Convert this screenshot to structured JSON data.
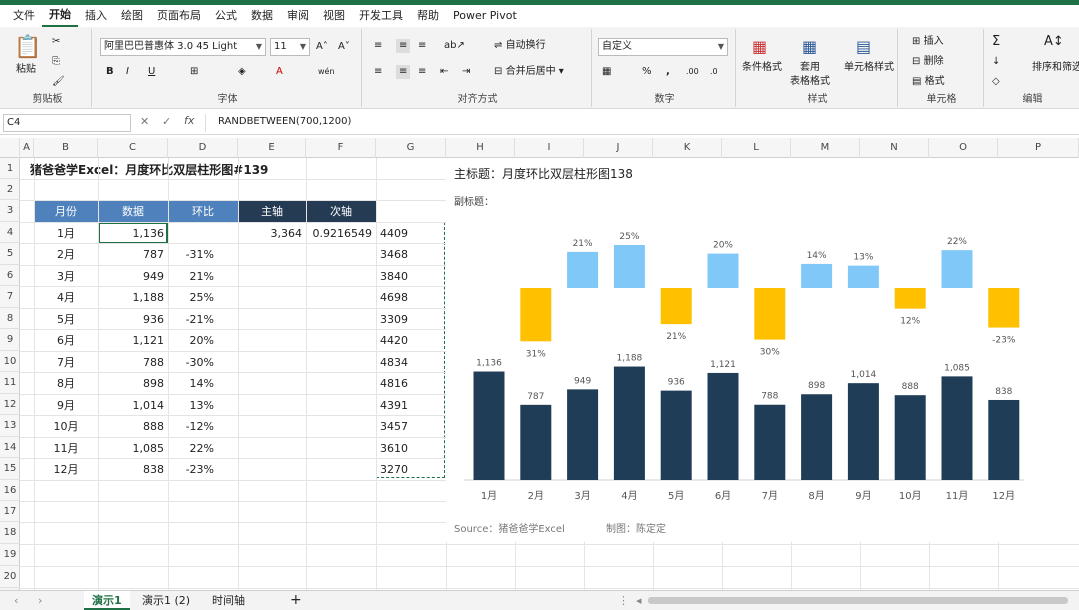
{
  "menu": [
    "文件",
    "开始",
    "插入",
    "绘图",
    "页面布局",
    "公式",
    "数据",
    "审阅",
    "视图",
    "开发工具",
    "帮助",
    "Power Pivot"
  ],
  "ribbon": {
    "paste": "粘贴",
    "clipboard": "剪贴板",
    "font_name": "阿里巴巴普惠体 3.0 45 Light",
    "font_size": "11",
    "font": "字体",
    "wrap": "自动换行",
    "merge": "合并后居中",
    "alignment": "对齐方式",
    "number_format": "自定义",
    "number": "数字",
    "cond_fmt": "条件格式",
    "table_fmt_1": "套用",
    "table_fmt_2": "表格格式",
    "cell_style": "单元格样式",
    "styles": "样式",
    "insert": "插入",
    "delete": "删除",
    "format": "格式",
    "cells": "单元格",
    "edit": "编辑",
    "sort": "排序和筛选"
  },
  "formula_bar": {
    "name_box": "C4",
    "formula": "RANDBETWEEN(700,1200)"
  },
  "columns": [
    "A",
    "B",
    "C",
    "D",
    "E",
    "F",
    "G",
    "H",
    "I",
    "J",
    "K",
    "L",
    "M",
    "N",
    "O",
    "P"
  ],
  "rows": [
    "1",
    "2",
    "3",
    "4",
    "5",
    "6",
    "7",
    "8",
    "9",
    "10",
    "11",
    "12",
    "13",
    "14",
    "15",
    "16",
    "17",
    "18",
    "19",
    "20"
  ],
  "sheet_title": "猪爸爸学Excel：月度环比双层柱形图#139",
  "table": {
    "headers": [
      "月份",
      "数据",
      "环比",
      "主轴",
      "次轴"
    ],
    "main_axis": "3,364",
    "secondary_axis": "0.9216549",
    "rows": [
      [
        "1月",
        "1,136",
        ""
      ],
      [
        "2月",
        "787",
        "-31%"
      ],
      [
        "3月",
        "949",
        "21%"
      ],
      [
        "4月",
        "1,188",
        "25%"
      ],
      [
        "5月",
        "936",
        "-21%"
      ],
      [
        "6月",
        "1,121",
        "20%"
      ],
      [
        "7月",
        "788",
        "-30%"
      ],
      [
        "8月",
        "898",
        "14%"
      ],
      [
        "9月",
        "1,014",
        "13%"
      ],
      [
        "10月",
        "888",
        "-12%"
      ],
      [
        "11月",
        "1,085",
        "22%"
      ],
      [
        "12月",
        "838",
        "-23%"
      ]
    ],
    "g_values": [
      "4409",
      "3468",
      "3840",
      "4698",
      "3309",
      "4420",
      "4834",
      "4816",
      "4391",
      "3457",
      "3610",
      "3270"
    ]
  },
  "chart_data": {
    "type": "bar",
    "title": "主标题：月度环比双层柱形图138",
    "subtitle": "副标题：",
    "categories": [
      "1月",
      "2月",
      "3月",
      "4月",
      "5月",
      "6月",
      "7月",
      "8月",
      "9月",
      "10月",
      "11月",
      "12月"
    ],
    "series": [
      {
        "values": [
          1136,
          787,
          949,
          1188,
          936,
          1121,
          788,
          898,
          1014,
          888,
          1085,
          838
        ],
        "labels": [
          "1,136",
          "787",
          "949",
          "1,188",
          "936",
          "1,121",
          "788",
          "898",
          "1,014",
          "888",
          "1,085",
          "838"
        ]
      },
      {
        "values": [
          null,
          -31,
          21,
          25,
          -21,
          20,
          -30,
          14,
          13,
          -12,
          22,
          -23
        ],
        "labels": [
          "",
          "31%",
          "21%",
          "25%",
          "21%",
          "20%",
          "30%",
          "14%",
          "13%",
          "12%",
          "22%",
          "-23%"
        ]
      }
    ],
    "colors": {
      "bars": "#1f3d56",
      "positive": "#7fc8f8",
      "negative": "#ffc000"
    },
    "source": "Source：猪爸爸学Excel",
    "author": "制图：陈定定"
  },
  "sheets": [
    "演示1",
    "演示1 (2)",
    "时间轴"
  ],
  "colors": {
    "accent": "#1e7145",
    "header_blue": "#4f81bd",
    "header_dark": "#243b53"
  }
}
